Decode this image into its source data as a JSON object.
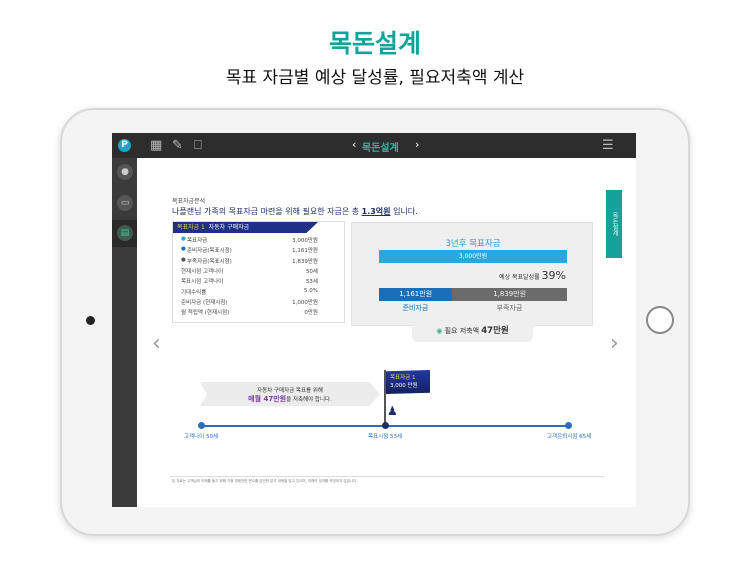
{
  "headline": "목돈설계",
  "subheadline": "목표 자금별 예상 달성률, 필요저축액 계산",
  "app": {
    "nav_title": "목돈설계",
    "side_tab": "목돈설계"
  },
  "section_label": "목표자금분석",
  "summary": {
    "prefix": "나플랜님 가족의 목표자금 마련을 위해 필요한 자금은 총 ",
    "amount": "1.3억원",
    "suffix": " 입니다."
  },
  "goal_table": {
    "header_tag": "목표자금 1",
    "header_title": "자동차 구매자금",
    "rows": [
      {
        "label": "목표자금",
        "value": "3,000만원",
        "dot": "#29a8e0"
      },
      {
        "label": "준비자금(목표시점)",
        "value": "1,161만원",
        "dot": "#1b6fba"
      },
      {
        "label": "부족자금(목표시점)",
        "value": "1,839만원",
        "dot": "#555555"
      },
      {
        "label": "현재시점 고객나이",
        "value": "50세"
      },
      {
        "label": "목표시점 고객나이",
        "value": "53세"
      },
      {
        "label": "기대수익률",
        "value": "5.0%"
      },
      {
        "label": "준비자금 (현재시점)",
        "value": "1,000만원"
      },
      {
        "label": "월 적립액 (현재시점)",
        "value": "0만원"
      }
    ]
  },
  "goal_chart": {
    "title": "3년후 목표자금",
    "target": "3,000만원",
    "rate_label": "예상 목표달성률",
    "rate": "39%",
    "rate_value": 39,
    "prepared": "1,161만원",
    "shortfall": "1,839만원",
    "prepared_label": "준비자금",
    "shortfall_label": "부족자금",
    "needed_label": "필요 저축액",
    "needed": "47만원"
  },
  "timeline": {
    "callout_line1": "자동차 구매자금 목표를 위해",
    "callout_highlight": "매월 47만원",
    "callout_rest": "을 저축해야 합니다.",
    "flag_tag": "목표자금 1",
    "flag_amount": "3,000 만원",
    "points": [
      "고객나이 50세",
      "목표시점 53세",
      "고객은퇴시점 65세"
    ]
  },
  "footnote": "본 자료는 고객님의 이해를 돕기 위해 가정 경제전망 변수를 감안한 분석 내용을 담고 있으며, 미래의 성과를 보장하지 않습니다."
}
